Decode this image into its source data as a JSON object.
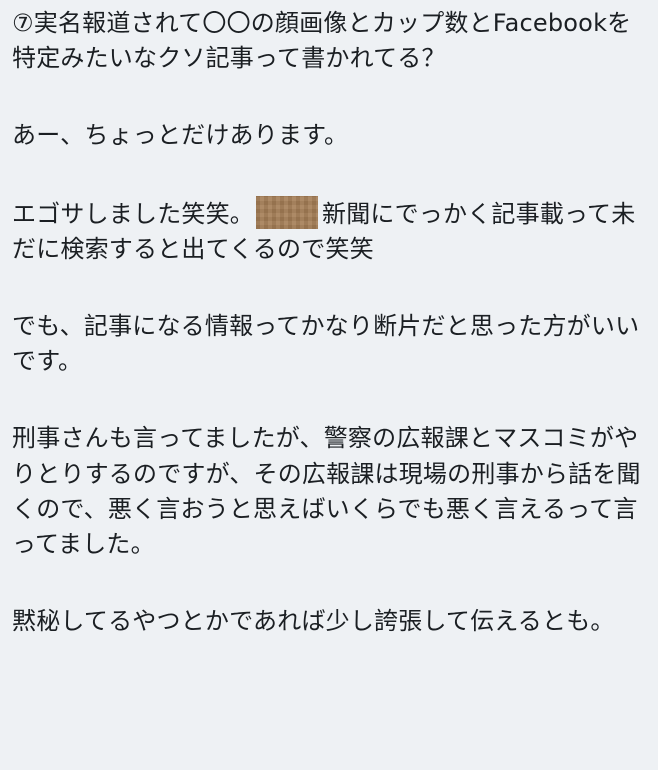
{
  "post": {
    "p1": "⑦実名報道されて〇〇の顔画像とカップ数とFacebookを特定みたいなクソ記事って書かれてる？",
    "p2": "あー、ちょっとだけあります。",
    "p3a": "エゴサしました笑笑。",
    "p3b": "新聞にでっかく記事載って未だに検索すると出てくるので笑笑",
    "p4": "でも、記事になる情報ってかなり断片だと思った方がいいです。",
    "p5": "刑事さんも言ってましたが、警察の広報課とマスコミがやりとりするのですが、その広報課は現場の刑事から話を聞くので、悪く言おうと思えばいくらでも悪く言えるって言ってました。",
    "p6": "黙秘してるやつとかであれば少し誇張して伝えるとも。"
  },
  "colors": {
    "background": "#eef1f4",
    "text": "#1b1f23",
    "censor": "#a67f57"
  }
}
